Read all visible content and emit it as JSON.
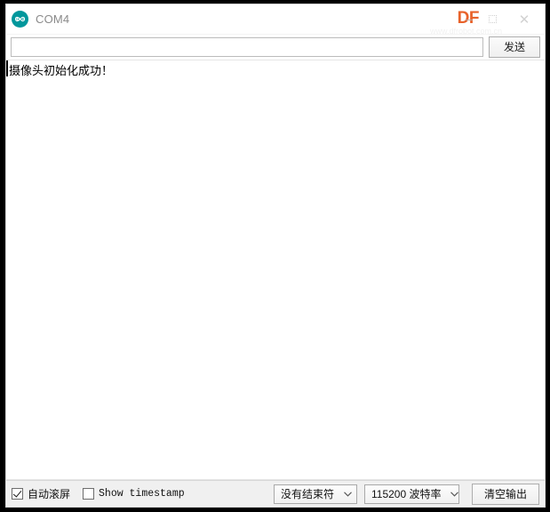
{
  "window": {
    "title": "COM4",
    "app_icon": "arduino-infinity-icon",
    "brand_overlay": "DF",
    "brand_color": "#e8622a",
    "watermark": "www.dfrobot.com.cn",
    "controls": {
      "minimize": "–",
      "maximize": "maximize-icon",
      "close": "✕"
    }
  },
  "send_row": {
    "input_value": "",
    "input_placeholder": "",
    "send_label": "发送"
  },
  "console": {
    "lines": [
      "摄像头初始化成功！"
    ],
    "line_0": "摄像头初始化成功！"
  },
  "statusbar": {
    "autoscroll": {
      "label": "自动滚屏",
      "checked": true
    },
    "timestamp": {
      "label": "Show timestamp",
      "checked": false
    },
    "line_ending": {
      "selected": "没有结束符",
      "chevron": "chevron-down-icon"
    },
    "baud_rate": {
      "selected": "115200 波特率",
      "chevron": "chevron-down-icon"
    },
    "clear_output_label": "清空输出"
  }
}
